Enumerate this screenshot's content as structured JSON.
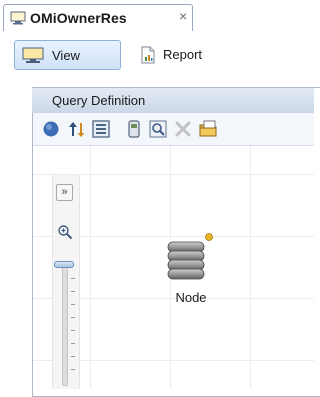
{
  "tab": {
    "title": "OMiOwnerRes",
    "close_glyph": "×",
    "icon": "view-icon"
  },
  "toolbar": {
    "view_label": "View",
    "view_icon": "view-icon",
    "report_label": "Report",
    "report_icon": "report-icon"
  },
  "query_panel": {
    "title": "Query Definition",
    "tools": [
      {
        "name": "globe-icon"
      },
      {
        "name": "sort-icon"
      },
      {
        "name": "properties-icon"
      },
      {
        "name": "layer-icon"
      },
      {
        "name": "find-icon"
      },
      {
        "name": "delete-icon"
      },
      {
        "name": "folder-icon"
      }
    ]
  },
  "canvas": {
    "expand_glyph": "»",
    "zoom_icon": "zoom-in-icon",
    "zoom_level": 0.02,
    "node": {
      "label": "Node",
      "icon": "node-stack-icon",
      "badge_color": "#e8b52a"
    }
  },
  "colors": {
    "accent": "#8fb1d8",
    "header_bg": "#cbd7e6"
  }
}
